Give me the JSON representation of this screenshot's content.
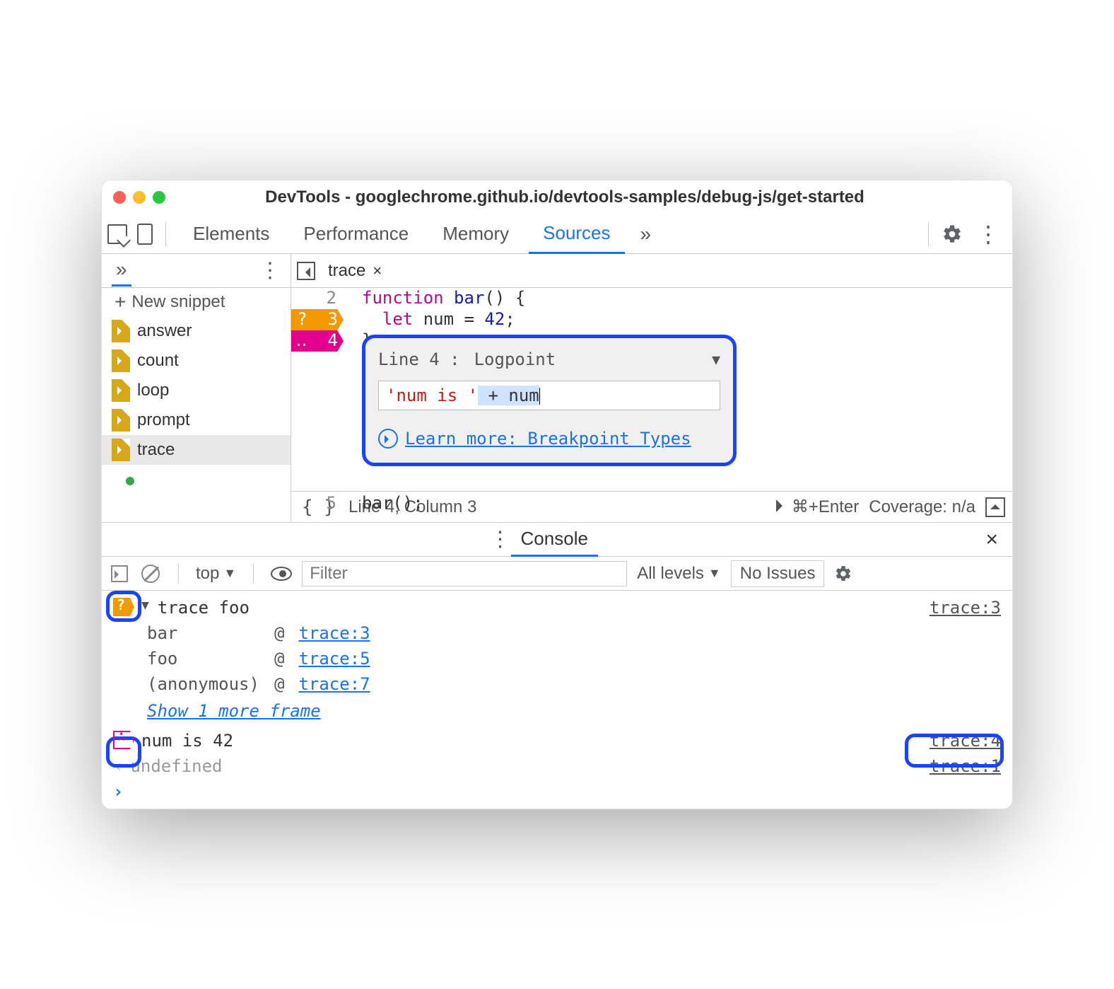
{
  "window": {
    "title": "DevTools - googlechrome.github.io/devtools-samples/debug-js/get-started"
  },
  "panels": {
    "tabs": [
      "Elements",
      "Performance",
      "Memory",
      "Sources"
    ],
    "active": "Sources",
    "more": "»"
  },
  "sidebar": {
    "more": "»",
    "new_snippet": "New snippet",
    "files": [
      "answer",
      "count",
      "loop",
      "prompt",
      "trace"
    ],
    "selected": "trace"
  },
  "editor": {
    "tab": "trace",
    "lines": {
      "l2": {
        "n": "2",
        "code_fn": "function",
        "code_name": " bar",
        "code_rest": "() {"
      },
      "l3": {
        "n": "3",
        "cond_mark": "?",
        "let": "let",
        "var": " num ",
        "eq": "= ",
        "val": "42",
        "semi": ";"
      },
      "l4": {
        "n": "4",
        "log_mark": "‥",
        "brace": "}"
      },
      "l5": {
        "n": "5",
        "call": "bar();"
      }
    },
    "popup": {
      "line_label": "Line 4 :",
      "type": "Logpoint",
      "expr_str": "'num is '",
      "expr_rest": " + num",
      "learn_more": "Learn more: Breakpoint Types"
    },
    "status": {
      "pos": "Line 4, Column 3",
      "run": "⌘+Enter",
      "coverage": "Coverage: n/a"
    }
  },
  "console": {
    "tab": "Console",
    "context": "top",
    "filter_ph": "Filter",
    "levels": "All levels",
    "no_issues": "No Issues",
    "rows": {
      "r1": {
        "text": "trace foo",
        "src": "trace:3"
      },
      "stack": [
        {
          "fn": "bar",
          "at": "@",
          "link": "trace:3"
        },
        {
          "fn": "foo",
          "at": "@",
          "link": "trace:5"
        },
        {
          "fn": "(anonymous)",
          "at": "@",
          "link": "trace:7"
        }
      ],
      "show_more": "Show 1 more frame",
      "r2": {
        "text": "num is 42",
        "src": "trace:4"
      },
      "r3": {
        "text": "undefined",
        "src": "trace:1"
      }
    }
  }
}
